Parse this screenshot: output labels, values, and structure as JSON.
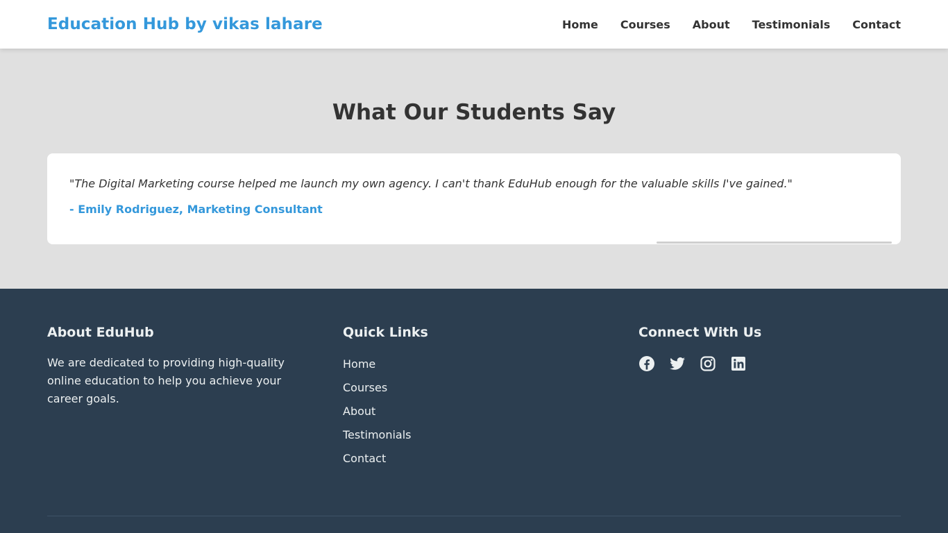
{
  "header": {
    "brand": "Education Hub by vikas lahare",
    "nav": [
      {
        "label": "Home"
      },
      {
        "label": "Courses"
      },
      {
        "label": "About"
      },
      {
        "label": "Testimonials"
      },
      {
        "label": "Contact"
      }
    ]
  },
  "testimonials": {
    "title": "What Our Students Say",
    "items": [
      {
        "quote": "\"The Digital Marketing course helped me launch my own agency. I can't thank EduHub enough for the valuable skills I've gained.\"",
        "author": "- Emily Rodriguez, Marketing Consultant"
      }
    ]
  },
  "footer": {
    "about": {
      "title": "About EduHub",
      "text": "We are dedicated to providing high-quality online education to help you achieve your career goals."
    },
    "quick_links": {
      "title": "Quick Links",
      "links": [
        {
          "label": "Home"
        },
        {
          "label": "Courses"
        },
        {
          "label": "About"
        },
        {
          "label": "Testimonials"
        },
        {
          "label": "Contact"
        }
      ]
    },
    "connect": {
      "title": "Connect With Us",
      "icons": [
        "facebook-icon",
        "twitter-icon",
        "instagram-icon",
        "linkedin-icon"
      ]
    }
  },
  "colors": {
    "accent": "#3498db",
    "footer_bg": "#2c3e50",
    "section_bg": "#e0e0e0",
    "text": "#333333"
  }
}
